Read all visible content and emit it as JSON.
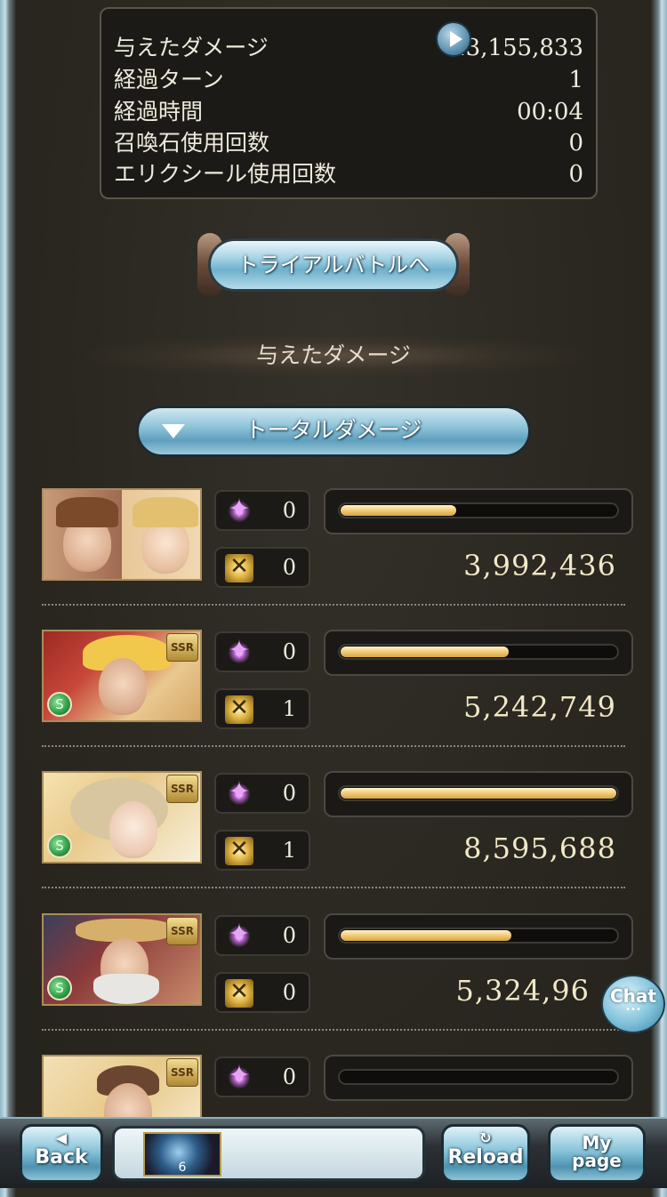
{
  "stats": {
    "rows": [
      {
        "label": "与えたダメージ",
        "value": "23,155,833"
      },
      {
        "label": "経過ターン",
        "value": "1"
      },
      {
        "label": "経過時間",
        "value": "00:04"
      },
      {
        "label": "召喚石使用回数",
        "value": "0"
      },
      {
        "label": "エリクシール使用回数",
        "value": "0"
      }
    ],
    "icon": "play-icon"
  },
  "trial_button": {
    "label": "トライアルバトルへ"
  },
  "section": {
    "title": "与えたダメージ"
  },
  "dropdown": {
    "label": "トータルダメージ",
    "icon": "triangle-down-icon"
  },
  "characters": [
    {
      "portrait": "dual-character-portrait",
      "ssr": "",
      "element": "",
      "skill_count": "0",
      "attack_count": "0",
      "damage": "3,992,436",
      "bar_fraction": 0.42
    },
    {
      "portrait": "blonde-warrior-portrait",
      "ssr": "SSR",
      "element": "wind",
      "skill_count": "0",
      "attack_count": "1",
      "damage": "5,242,749",
      "bar_fraction": 0.61
    },
    {
      "portrait": "horned-lady-portrait",
      "ssr": "SSR",
      "element": "wind",
      "skill_count": "0",
      "attack_count": "1",
      "damage": "8,595,688",
      "bar_fraction": 1.0
    },
    {
      "portrait": "elder-sage-portrait",
      "ssr": "SSR",
      "element": "wind",
      "skill_count": "0",
      "attack_count": "0",
      "damage": "5,324,96",
      "bar_fraction": 0.62
    },
    {
      "portrait": "bearded-man-portrait",
      "ssr": "SSR",
      "element": "",
      "skill_count": "0",
      "attack_count": "",
      "damage": "",
      "bar_fraction": 0.0
    }
  ],
  "chat": {
    "label": "Chat",
    "dots": "•••"
  },
  "nav": {
    "back": {
      "label": "Back",
      "icon": "◀"
    },
    "reload": {
      "label": "Reload",
      "icon": "↻"
    },
    "mypage": {
      "label_line1": "My",
      "label_line2": "page"
    },
    "quest_number": "6"
  },
  "colors": {
    "bar": "#f3cf7e",
    "accent": "#8fc4da",
    "panel": "#1b1a16"
  }
}
